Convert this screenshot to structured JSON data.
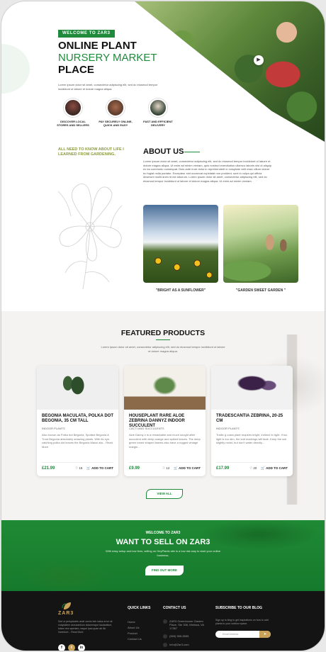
{
  "hero": {
    "tag": "WELCOME TO ZAR3",
    "title_line1": "ONLINE PLANT",
    "title_line2": "NURSERY MARKET",
    "title_line3": "PLACE",
    "description": "Lorem ipsum dolor sit amet, consectetur adipiscing elit, sed do eiusmod tempor incididunt ut labore et dolore magna aliqua.",
    "features": [
      {
        "label": "DISCOVER LOCAL STORES AND SELLERS"
      },
      {
        "label": "PAY SECURELY ONLINE, QUICK AND EASY"
      },
      {
        "label": "FAST AND EFFICIENT DELIVERY"
      }
    ]
  },
  "about": {
    "side_title": "ALL NEED TO KNOW ABOUT LIFE I LEARNED FROM GARDENING.",
    "title": "ABOUT US",
    "text": "Lorem ipsum dolor sit amet, consectetur adipiscing elit, sed do eiusmod tempor incididunt ut labore et dolore magna aliqua. Ut enim ad minim veniam, quis nostrud exercitation ullamco laboris nisi ut aliquip ex ea commodo consequat. Duis aute irure dolor in reprehenderit in voluptate velit esse cillum dolore eu fugiat nulla pariatur. Excepteur sint occaecat cupidatat non proident, sunt in culpa qui officia deserunt mollit anim id est laborum. Lorem ipsum dolor sit amet, consectetur adipiscing elit, sed do eiusmod tempor incididunt ut labore et dolore magna aliqua. Ut enim ad minim veniam.",
    "photo1_caption": "\"BRIGHT AS A SUNFLOWER\"",
    "photo2_caption": "\"GARDEN SWEET GARDEN \""
  },
  "featured": {
    "title": "FEATURED PRODUCTS",
    "description": "Lorem ipsum dolor sit amet, consectetur adipiscing elit, sed do eiusmod tempor incididunt ut labore et dolore magna aliqua.",
    "products": [
      {
        "title": "BEGONIA MACULATA, POLKA DOT BEGONIA, 35 CM TALL",
        "category": "INDOOR PLANTS",
        "description": "Also known as Polka dot Begonia, Spotted Begonia & Trout Begonia absolutely amazing plants. With its eye-catching polka dot leaves the Begonia Macul ata... Read More",
        "price": "£21.99",
        "likes": "15",
        "cta": "ADD TO CART"
      },
      {
        "title": "HOUSEPLANT RARE ALOE ZEBRINA DANNYZ INDOOR SUCCULENT",
        "category": "CACTI AND SUCCULENTS",
        "description": "Aloe Danny z is a remarkable and much sought after succulent with deep orange and spiked leaves. The deep green toned shaped leaves also have a rugged vintage margin...",
        "price": "£9.99",
        "likes": "12",
        "cta": "ADD TO CART"
      },
      {
        "title": "TRADESCANTIA ZEBRINA, 20-25 CM",
        "category": "INDOOR PLANTS",
        "description": "Trailin g costa plant requires bright, indirect to light. If too light is too dim, the leaf markings will fade. Keep the soil slightly moist, but don't water directly...",
        "price": "£17.99",
        "likes": "20",
        "cta": "ADD TO CART"
      }
    ],
    "view_all": "VIEW ALL"
  },
  "cta": {
    "small": "WELCOME TO ZAR3",
    "title": "WANT TO SELL ON ZAR3",
    "description": "With easy setup and low fees, selling on HeyPlants site is a low risk way to start your online business.",
    "button": "FIND OUT MORE"
  },
  "footer": {
    "logo_text": "ZAR3",
    "about": "Sed ut perspiciatis unde omnis iste natus error sit voluptatem accusantium doloremque laudantium, totam rem aperiam, eaque ipsa quae ab illo inventore... Read More",
    "quick_links_title": "QUICK LINKS",
    "quick_links": [
      "Home",
      "About Us",
      "Product",
      "Contact Us"
    ],
    "contact_title": "CONTACT US",
    "contact": [
      "ZAR3 Greenhouse Garden Place, Ste 306, Melissa, VA 17367",
      "(555) 555-5555",
      "Info@Zar3.com"
    ],
    "subscribe_title": "SUBSCRIBE TO OUR BLOG",
    "subscribe_desc": "Sign up to blog to get inspirations on how to add plants to your outdoor space.",
    "email_placeholder": "Email Address",
    "social": [
      "f",
      "t",
      "in"
    ],
    "accent": "#c9a25a"
  },
  "colors": {
    "primary": "#1f8a3b",
    "accent_olive": "#8c9a3f",
    "footer_bg": "#141414"
  }
}
